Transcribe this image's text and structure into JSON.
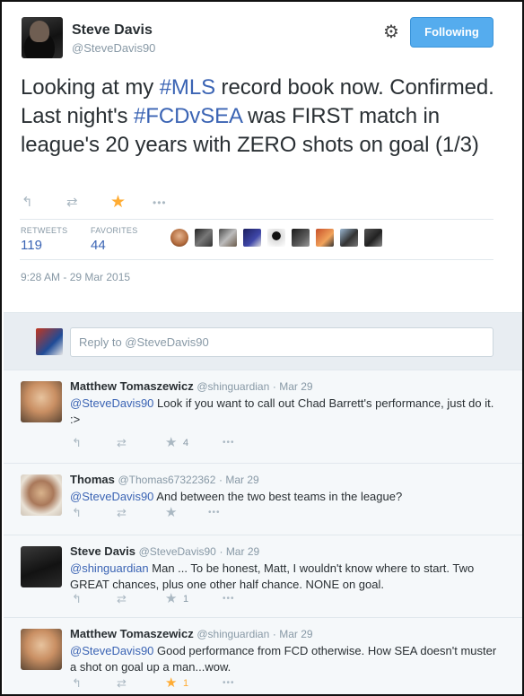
{
  "tweet": {
    "author_name": "Steve Davis",
    "author_handle": "@SteveDavis90",
    "follow_label": "Following",
    "text_1": "Looking at my ",
    "hashtag_1": "#MLS",
    "text_2": " record book now. Confirmed. Last night's ",
    "hashtag_2": "#FCDvSEA",
    "text_3": " was FIRST match in league's 20 years with ZERO shots on goal (1/3)",
    "retweets_label": "RETWEETS",
    "retweets_count": "119",
    "favorites_label": "FAVORITES",
    "favorites_count": "44",
    "timestamp": "9:28 AM - 29 Mar 2015",
    "favorited": true
  },
  "icons": {
    "reply": "↰",
    "retweet": "⇄",
    "star": "★",
    "more": "•••",
    "gear": "⚙"
  },
  "reply_box": {
    "placeholder": "Reply to @SteveDavis90"
  },
  "replies": [
    {
      "name": "Matthew Tomaszewicz",
      "handle": "@shinguardian",
      "time": "· Mar 29",
      "mention": "@SteveDavis90",
      "text": " Look if you want to call out Chad Barrett's performance, just do it. :>",
      "fav_count": "4",
      "favorited": false
    },
    {
      "name": "Thomas",
      "handle": "@Thomas67322362",
      "time": "· Mar 29",
      "mention": "@SteveDavis90",
      "text": " And between the two best teams in the league?",
      "fav_count": "",
      "favorited": false
    },
    {
      "name": "Steve Davis",
      "handle": "@SteveDavis90",
      "time": "· Mar 29",
      "mention": "@shinguardian",
      "text": " Man ... To be honest, Matt, I wouldn't know where to start. Two GREAT chances, plus one other half chance. NONE on goal.",
      "fav_count": "1",
      "favorited": false
    },
    {
      "name": "Matthew Tomaszewicz",
      "handle": "@shinguardian",
      "time": "· Mar 29",
      "mention": "@SteveDavis90",
      "text": " Good performance from FCD otherwise. How SEA doesn't muster a shot on goal up a man...wow.",
      "fav_count": "1",
      "favorited": true
    }
  ]
}
